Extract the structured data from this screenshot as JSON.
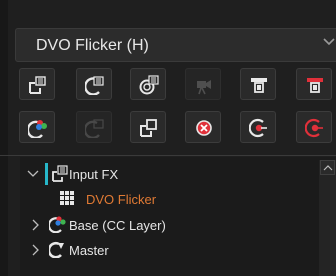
{
  "node_selector": {
    "value": "DVO Flicker (H)"
  },
  "toolbar": {
    "row1": [
      {
        "icon": "add-node-icon",
        "disabled": false
      },
      {
        "icon": "add-cache-node-icon",
        "disabled": false
      },
      {
        "icon": "add-multi-node-icon",
        "disabled": false
      },
      {
        "icon": "camera-node-icon",
        "disabled": true
      },
      {
        "icon": "input-marker-icon",
        "disabled": false
      },
      {
        "icon": "output-marker-red-icon",
        "disabled": false
      }
    ],
    "row2": [
      {
        "icon": "composite-layer-icon",
        "disabled": false
      },
      {
        "icon": "mask-node-icon",
        "disabled": true
      },
      {
        "icon": "parent-node-icon",
        "disabled": false
      },
      {
        "icon": "bypass-icon",
        "disabled": false
      },
      {
        "icon": "record-target-icon",
        "disabled": false
      },
      {
        "icon": "record-target-red-icon",
        "disabled": false
      }
    ]
  },
  "tree": {
    "items": [
      {
        "label": "Input FX",
        "expanded": true
      },
      {
        "label": "DVO Flicker",
        "color": "#e07a34"
      },
      {
        "label": "Base (CC Layer)",
        "expanded": false
      },
      {
        "label": "Master",
        "expanded": false
      }
    ]
  },
  "colors": {
    "accent": "#27b7c9",
    "active_item": "#e07a34",
    "danger": "#e0303a"
  }
}
